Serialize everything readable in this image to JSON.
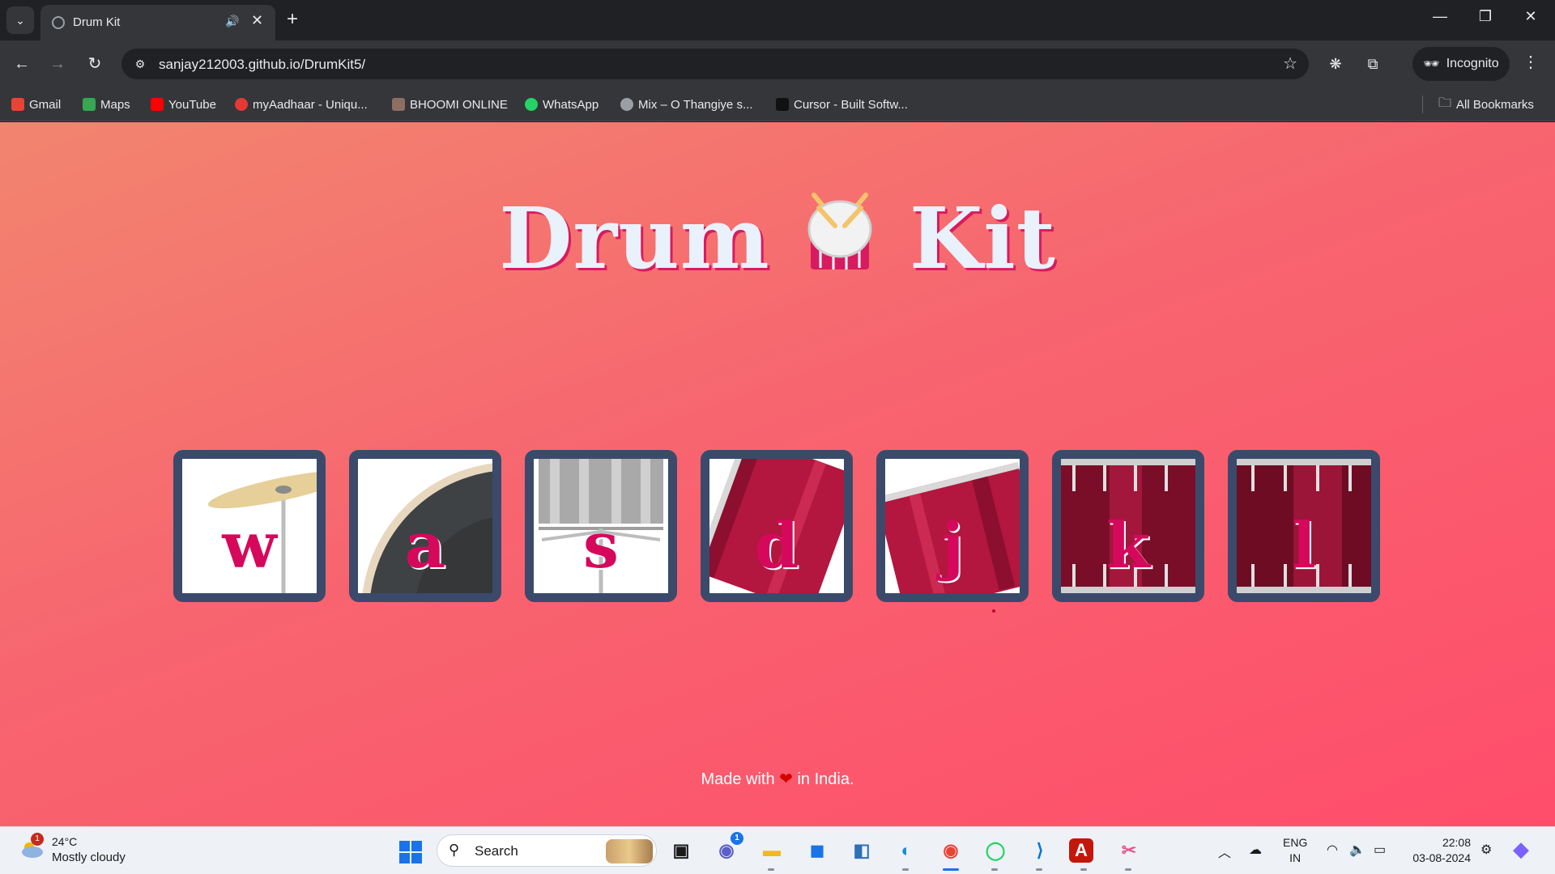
{
  "browser": {
    "tab": {
      "title": "Drum Kit"
    },
    "url": "sanjay212003.github.io/DrumKit5/",
    "profile_label": "Incognito",
    "bookmarks": [
      {
        "label": "Gmail",
        "color": "#ea4335"
      },
      {
        "label": "Maps",
        "color": "#34a853"
      },
      {
        "label": "YouTube",
        "color": "#ff0000"
      },
      {
        "label": "myAadhaar - Uniqu...",
        "color": "#e53935"
      },
      {
        "label": "BHOOMI ONLINE",
        "color": "#8d6e63"
      },
      {
        "label": "WhatsApp",
        "color": "#25d366"
      },
      {
        "label": "Mix – O Thangiye s...",
        "color": "#9aa0a6"
      },
      {
        "label": "Cursor - Built Softw...",
        "color": "#111111"
      }
    ],
    "all_bookmarks_label": "All Bookmarks"
  },
  "page": {
    "title_left": "Drum",
    "title_right": "Kit",
    "drums": [
      {
        "key": "w",
        "instrument": "crash"
      },
      {
        "key": "a",
        "instrument": "kick"
      },
      {
        "key": "s",
        "instrument": "snare"
      },
      {
        "key": "d",
        "instrument": "tom1"
      },
      {
        "key": "j",
        "instrument": "tom2"
      },
      {
        "key": "k",
        "instrument": "tom3"
      },
      {
        "key": "l",
        "instrument": "tom4"
      }
    ],
    "footer_before": "Made with",
    "footer_heart": "❤",
    "footer_after": "in India."
  },
  "taskbar": {
    "weather_badge": "1",
    "temperature": "24°C",
    "condition": "Mostly cloudy",
    "search_placeholder": "Search",
    "teams_badge": "1",
    "language_line1": "ENG",
    "language_line2": "IN",
    "time": "22:08",
    "date": "03-08-2024"
  },
  "colors": {
    "tile_border": "#3b4a6b",
    "letter": "#d6085c",
    "title_text": "#e9f1fb"
  }
}
